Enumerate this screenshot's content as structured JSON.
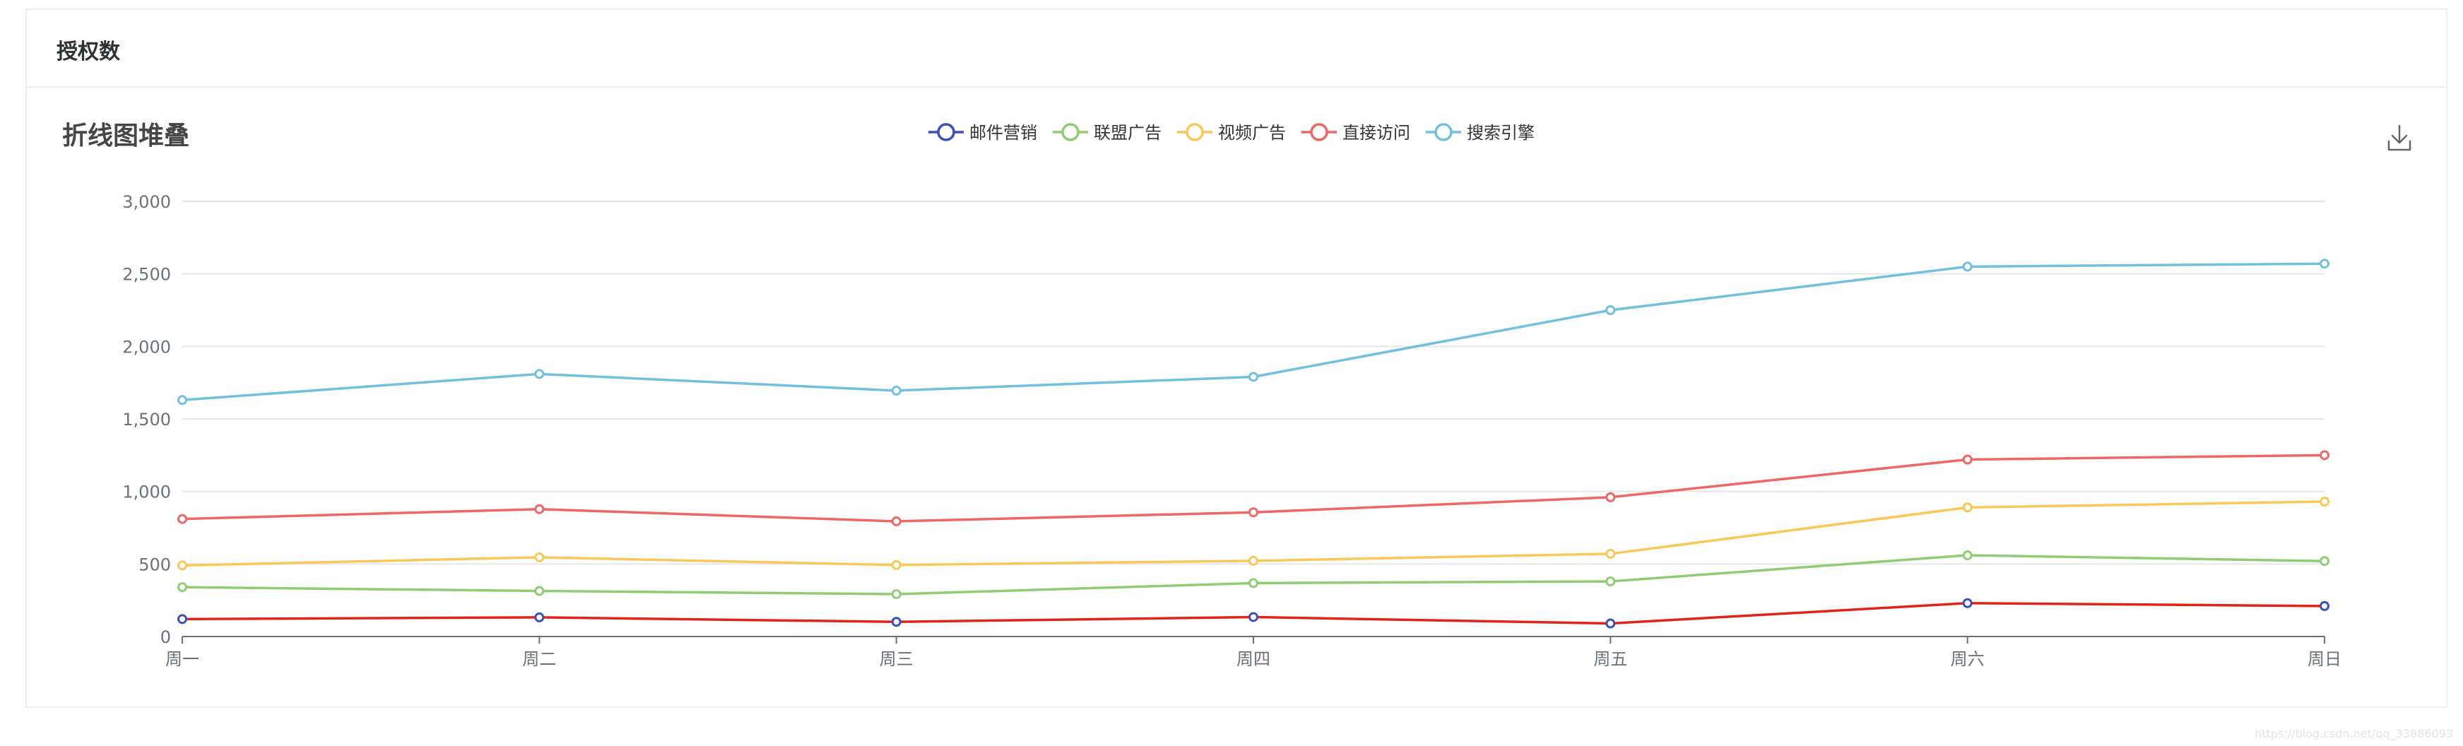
{
  "card": {
    "title": "授权数"
  },
  "chart_data": {
    "type": "line",
    "title": "折线图堆叠",
    "stacked": true,
    "categories": [
      "周一",
      "周二",
      "周三",
      "周四",
      "周五",
      "周六",
      "周日"
    ],
    "ylim": [
      0,
      3000
    ],
    "yticks": [
      "0",
      "500",
      "1,000",
      "1,500",
      "2,000",
      "2,500",
      "3,000"
    ],
    "grid": true,
    "legend_position": "top-center",
    "series": [
      {
        "name": "邮件营销",
        "color": "#3c4fb5",
        "line_color": "#e2231a",
        "values": [
          120,
          132,
          101,
          134,
          90,
          230,
          210
        ]
      },
      {
        "name": "联盟广告",
        "color": "#91cc75",
        "values": [
          220,
          182,
          191,
          234,
          290,
          330,
          310
        ]
      },
      {
        "name": "视频广告",
        "color": "#fac858",
        "values": [
          150,
          232,
          201,
          154,
          190,
          330,
          410
        ]
      },
      {
        "name": "直接访问",
        "color": "#ee6666",
        "values": [
          320,
          332,
          301,
          334,
          390,
          330,
          320
        ]
      },
      {
        "name": "搜索引擎",
        "color": "#73c0de",
        "values": [
          820,
          932,
          901,
          934,
          1290,
          1330,
          1320
        ]
      }
    ]
  },
  "toolbox": {
    "icon": "download-icon"
  },
  "watermark": "https://blog.csdn.net/qq_33886093"
}
